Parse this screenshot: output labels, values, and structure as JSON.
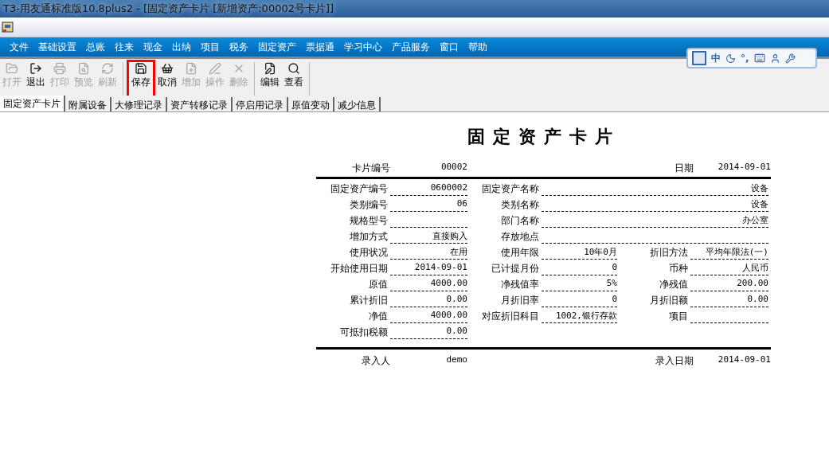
{
  "window": {
    "title": "T3-用友通标准版10.8plus2 - [固定资产卡片 [新增资产:00002号卡片]]"
  },
  "menu": [
    "文件",
    "基础设置",
    "总账",
    "往来",
    "现金",
    "出纳",
    "项目",
    "税务",
    "固定资产",
    "票据通",
    "学习中心",
    "产品服务",
    "窗口",
    "帮助"
  ],
  "ime_bar": {
    "mode": "中",
    "punctuation": "°,"
  },
  "toolbar": [
    {
      "kind": "button",
      "label": "打开",
      "disabled": true,
      "highlighted": false
    },
    {
      "kind": "button",
      "label": "退出",
      "disabled": false,
      "highlighted": false
    },
    {
      "kind": "button",
      "label": "打印",
      "disabled": true,
      "highlighted": false
    },
    {
      "kind": "button",
      "label": "预览",
      "disabled": true,
      "highlighted": false
    },
    {
      "kind": "button",
      "label": "刷新",
      "disabled": true,
      "highlighted": false
    },
    {
      "kind": "separator"
    },
    {
      "kind": "button",
      "label": "保存",
      "disabled": false,
      "highlighted": true
    },
    {
      "kind": "button",
      "label": "取消",
      "disabled": false,
      "highlighted": false
    },
    {
      "kind": "button",
      "label": "增加",
      "disabled": true,
      "highlighted": false
    },
    {
      "kind": "button",
      "label": "操作",
      "disabled": true,
      "highlighted": false
    },
    {
      "kind": "button",
      "label": "删除",
      "disabled": true,
      "highlighted": false
    },
    {
      "kind": "separator"
    },
    {
      "kind": "button",
      "label": "编辑",
      "disabled": false,
      "highlighted": false
    },
    {
      "kind": "button",
      "label": "查看",
      "disabled": false,
      "highlighted": false
    },
    {
      "kind": "separator"
    }
  ],
  "tabs": [
    {
      "label": "固定资产卡片",
      "selected": true
    },
    {
      "label": "附属设备",
      "selected": false
    },
    {
      "label": "大修理记录",
      "selected": false
    },
    {
      "label": "资产转移记录",
      "selected": false
    },
    {
      "label": "停启用记录",
      "selected": false
    },
    {
      "label": "原值变动",
      "selected": false
    },
    {
      "label": "减少信息",
      "selected": false
    }
  ],
  "card": {
    "title": "固定资产卡片",
    "header": [
      {
        "label": "卡片编号",
        "value": "00002"
      },
      {
        "label": "日期",
        "value": "2014-09-01"
      }
    ],
    "rows": [
      [
        {
          "label": "固定资产编号",
          "value": "0600002",
          "kind": "normal"
        },
        {
          "label": "固定资产名称",
          "value": "设备",
          "kind": "wide"
        }
      ],
      [
        {
          "label": "类别编号",
          "value": "06",
          "kind": "normal"
        },
        {
          "label": "类别名称",
          "value": "设备",
          "kind": "wide"
        }
      ],
      [
        {
          "label": "规格型号",
          "kind": "normal"
        },
        {
          "label": "部门名称",
          "value": "办公室",
          "kind": "wide"
        }
      ],
      [
        {
          "label": "增加方式",
          "value": "直接购入",
          "kind": "normal"
        },
        {
          "label": "存放地点",
          "kind": "wide"
        }
      ],
      [
        {
          "label": "使用状况",
          "value": "在用",
          "kind": "normal"
        },
        {
          "label": "使用年限",
          "value": "10年0月",
          "kind": "normal"
        },
        {
          "label": "折旧方法",
          "value": "平均年限法(一)",
          "kind": "normal"
        }
      ],
      [
        {
          "label": "开始使用日期",
          "value": "2014-09-01",
          "kind": "normal"
        },
        {
          "label": "已计提月份",
          "value": "0",
          "kind": "normal"
        },
        {
          "label": "币种",
          "value": "人民币",
          "kind": "normal"
        }
      ],
      [
        {
          "label": "原值",
          "value": "4000.00",
          "kind": "normal"
        },
        {
          "label": "净残值率",
          "value": "5%",
          "kind": "normal"
        },
        {
          "label": "净残值",
          "value": "200.00",
          "kind": "normal"
        }
      ],
      [
        {
          "label": "累计折旧",
          "value": "0.00",
          "kind": "normal"
        },
        {
          "label": "月折旧率",
          "value": "0",
          "kind": "normal"
        },
        {
          "label": "月折旧额",
          "value": "0.00",
          "kind": "normal"
        }
      ],
      [
        {
          "label": "净值",
          "value": "4000.00",
          "kind": "normal"
        },
        {
          "label": "对应折旧科目",
          "value": "1002,银行存款",
          "kind": "normal"
        },
        {
          "label": "项目",
          "kind": "normal"
        }
      ],
      [
        {
          "label": "可抵扣税额",
          "value": "0.00",
          "kind": "normal"
        }
      ]
    ],
    "footer": [
      {
        "label": "录入人",
        "value": "demo"
      },
      {
        "label": "录入日期",
        "value": "2014-09-01"
      }
    ]
  }
}
